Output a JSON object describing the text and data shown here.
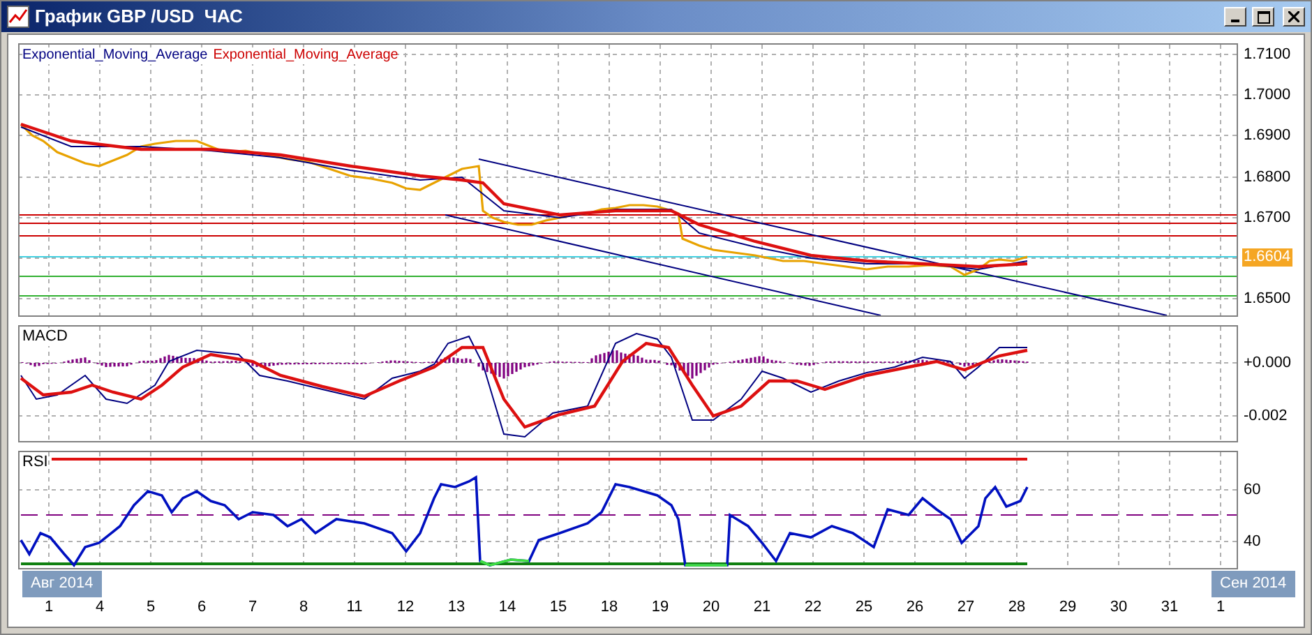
{
  "window": {
    "title": "График GBP /USD  ЧАС"
  },
  "price_panel": {
    "legend": [
      {
        "label": "Exponential_Moving_Average",
        "color": "#000080"
      },
      {
        "label": "Exponential_Moving_Average",
        "color": "#cc0000"
      }
    ],
    "y_labels": [
      "1.7100",
      "1.7000",
      "1.6900",
      "1.6800",
      "1.6700"
    ],
    "current_price": "1.6604",
    "y_labels_low": [
      "1.6500"
    ]
  },
  "macd_panel": {
    "title": "MACD",
    "y_labels": [
      "+0.000",
      "-0.002"
    ]
  },
  "rsi_panel": {
    "title": "RSI",
    "y_labels": [
      "60",
      "40"
    ]
  },
  "time_axis": {
    "labels": [
      "1",
      "4",
      "5",
      "6",
      "7",
      "8",
      "11",
      "12",
      "13",
      "14",
      "15",
      "18",
      "19",
      "20",
      "21",
      "22",
      "25",
      "26",
      "27",
      "28",
      "29",
      "30",
      "31",
      "1"
    ],
    "month_tags": [
      {
        "label": "Авг 2014"
      },
      {
        "label": "Сен 2014"
      }
    ]
  }
}
